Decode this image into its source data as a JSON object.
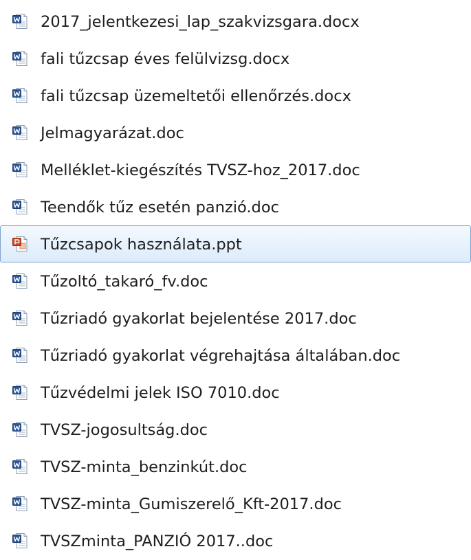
{
  "files": [
    {
      "name": "2017_jelentkezesi_lap_szakvizsgara.docx",
      "icon": "word-document-icon",
      "selected": false
    },
    {
      "name": "fali tűzcsap éves felülvizsg.docx",
      "icon": "word-document-icon",
      "selected": false
    },
    {
      "name": "fali tűzcsap üzemeltetői ellenőrzés.docx",
      "icon": "word-document-icon",
      "selected": false
    },
    {
      "name": "Jelmagyarázat.doc",
      "icon": "word-document-icon",
      "selected": false
    },
    {
      "name": "Melléklet-kiegészítés TVSZ-hoz_2017.doc",
      "icon": "word-document-icon",
      "selected": false
    },
    {
      "name": "Teendők tűz esetén panzió.doc",
      "icon": "word-document-icon",
      "selected": false
    },
    {
      "name": "Tűzcsapok használata.ppt",
      "icon": "powerpoint-document-icon",
      "selected": true
    },
    {
      "name": "Tűzoltó_takaró_fv.doc",
      "icon": "word-document-icon",
      "selected": false
    },
    {
      "name": "Tűzriadó gyakorlat bejelentése 2017.doc",
      "icon": "word-document-icon",
      "selected": false
    },
    {
      "name": "Tűzriadó gyakorlat végrehajtása általában.doc",
      "icon": "word-document-icon",
      "selected": false
    },
    {
      "name": "Tűzvédelmi jelek ISO 7010.doc",
      "icon": "word-document-icon",
      "selected": false
    },
    {
      "name": "TVSZ-jogosultság.doc",
      "icon": "word-document-icon",
      "selected": false
    },
    {
      "name": "TVSZ-minta_benzinkút.doc",
      "icon": "word-document-icon",
      "selected": false
    },
    {
      "name": "TVSZ-minta_Gumiszerelő_Kft-2017.doc",
      "icon": "word-document-icon",
      "selected": false
    },
    {
      "name": "TVSZminta_PANZIÓ  2017..doc",
      "icon": "word-document-icon",
      "selected": false
    }
  ],
  "colors": {
    "selection_border": "#7da2ce",
    "selection_fill": "#dcebfc",
    "word_blue": "#2b5797",
    "powerpoint_orange": "#d24726"
  }
}
